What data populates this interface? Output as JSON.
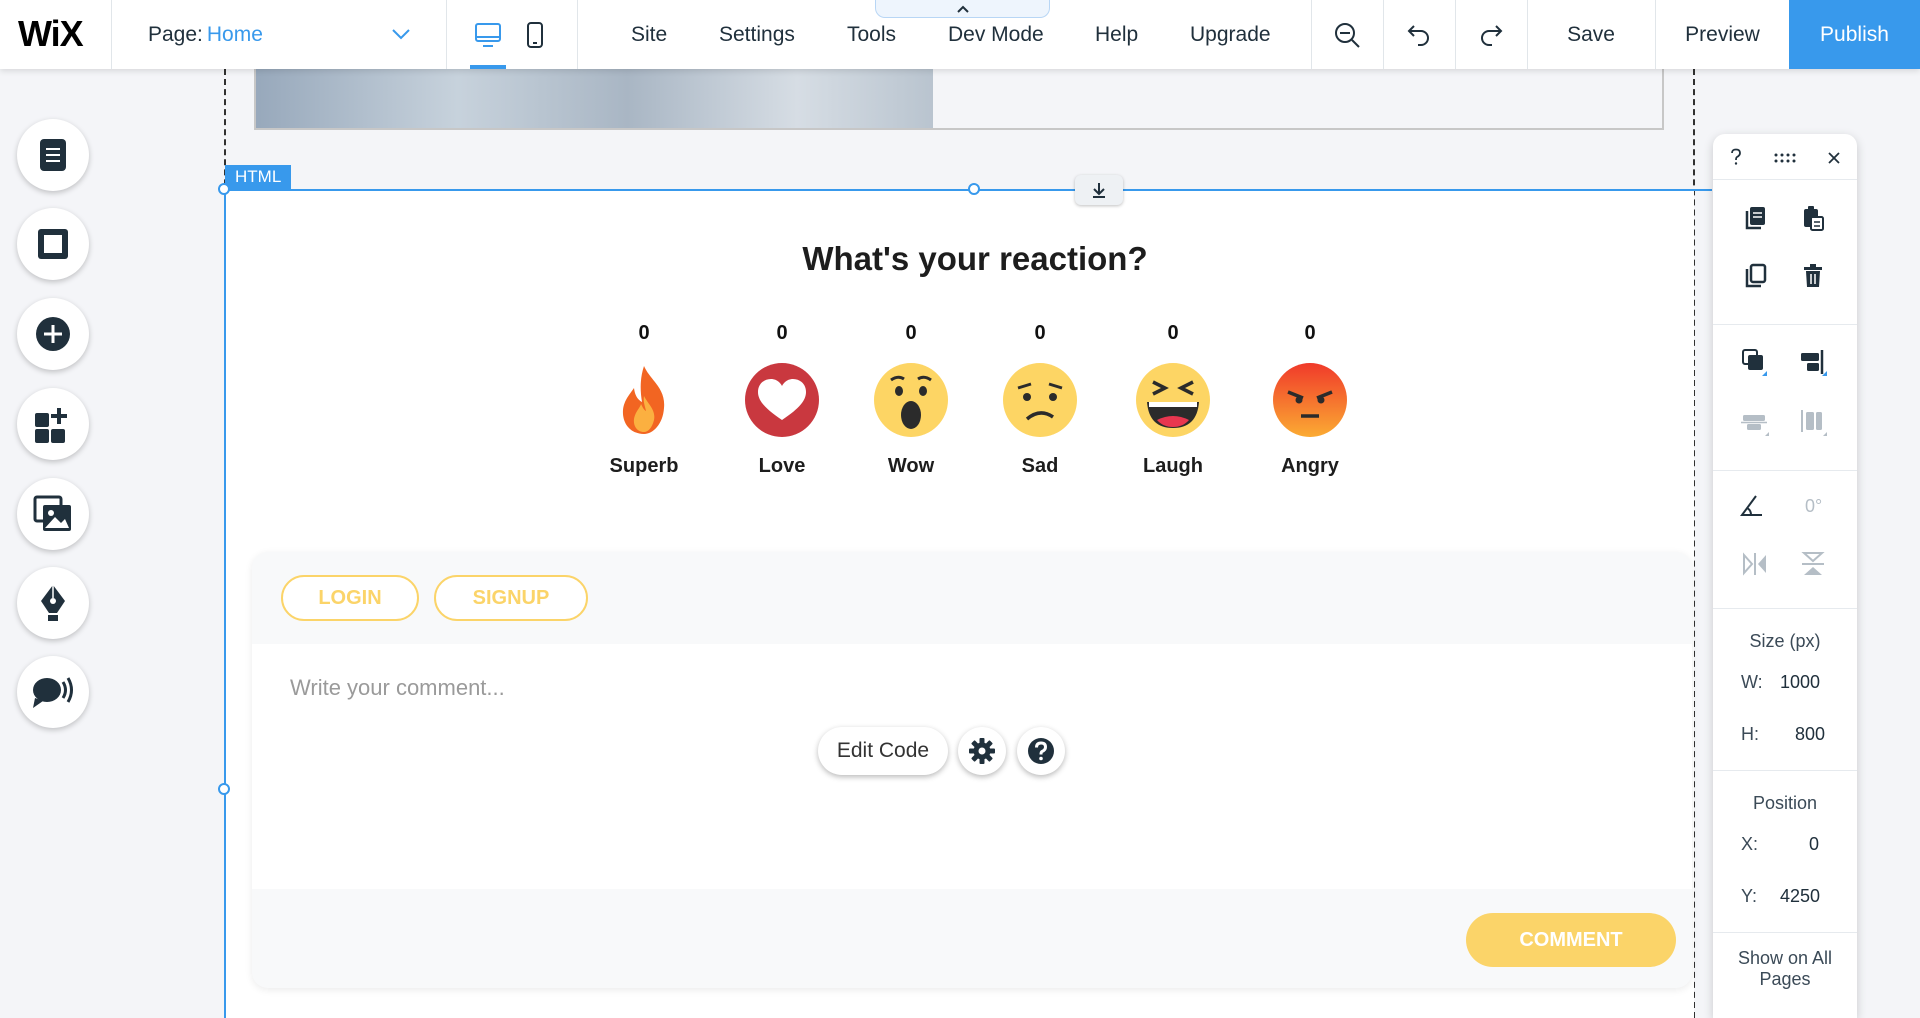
{
  "topbar": {
    "logo": "WiX",
    "page_label": "Page:",
    "page_value": "Home",
    "menu": [
      "Site",
      "Settings",
      "Tools",
      "Dev Mode",
      "Help",
      "Upgrade"
    ],
    "save_label": "Save",
    "preview_label": "Preview",
    "publish_label": "Publish"
  },
  "left_rail": {
    "icons": [
      "pages-icon",
      "background-icon",
      "add-icon",
      "add-apps-icon",
      "media-icon",
      "pen-icon",
      "chat-icon"
    ]
  },
  "canvas": {
    "html_tag": "HTML",
    "widget": {
      "title": "What's your reaction?",
      "reactions": [
        {
          "label": "Superb",
          "count": "0"
        },
        {
          "label": "Love",
          "count": "0"
        },
        {
          "label": "Wow",
          "count": "0"
        },
        {
          "label": "Sad",
          "count": "0"
        },
        {
          "label": "Laugh",
          "count": "0"
        },
        {
          "label": "Angry",
          "count": "0"
        }
      ],
      "login_label": "LOGIN",
      "signup_label": "SIGNUP",
      "comment_placeholder": "Write your comment...",
      "comment_button": "COMMENT"
    },
    "edit_code_label": "Edit Code"
  },
  "right_panel": {
    "rotation": "0°",
    "size_label": "Size (px)",
    "width_label": "W:",
    "width_value": "1000",
    "height_label": "H:",
    "height_value": "800",
    "position_label": "Position",
    "x_label": "X:",
    "x_value": "0",
    "y_label": "Y:",
    "y_value": "4250",
    "show_all_label": "Show on All Pages"
  },
  "colors": {
    "wix_blue": "#3899ec",
    "accent_yellow": "#fbd469",
    "text_dark": "#20303c"
  }
}
